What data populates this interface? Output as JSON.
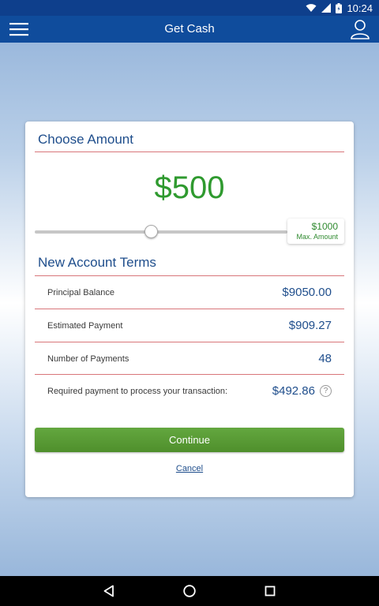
{
  "status_bar": {
    "time": "10:24",
    "icons": [
      "wifi-icon",
      "signal-icon",
      "battery-icon"
    ]
  },
  "app_bar": {
    "title": "Get Cash",
    "left_icon": "hamburger-menu-icon",
    "right_icon": "profile-icon"
  },
  "choose_amount": {
    "title": "Choose Amount",
    "amount": "$500",
    "slider": {
      "value": 500,
      "max": 1000,
      "max_value_label": "$1000",
      "max_label": "Max. Amount"
    }
  },
  "terms": {
    "title": "New Account Terms",
    "rows": [
      {
        "label": "Principal Balance",
        "value": "$9050.00"
      },
      {
        "label": "Estimated Payment",
        "value": "$909.27"
      },
      {
        "label": "Number of Payments",
        "value": "48"
      },
      {
        "label": "Required payment to process your transaction:",
        "value": "$492.86",
        "help_icon": "question-icon"
      }
    ]
  },
  "actions": {
    "continue_label": "Continue",
    "cancel_label": "Cancel"
  },
  "colors": {
    "app_bar": "#0f4c9c",
    "accent_green": "#2f9a2f",
    "accent_blue": "#1f4e8c",
    "divider_red": "#d8767a"
  },
  "nav_bar": {
    "icons": [
      "back-icon",
      "home-icon",
      "recents-icon"
    ]
  }
}
